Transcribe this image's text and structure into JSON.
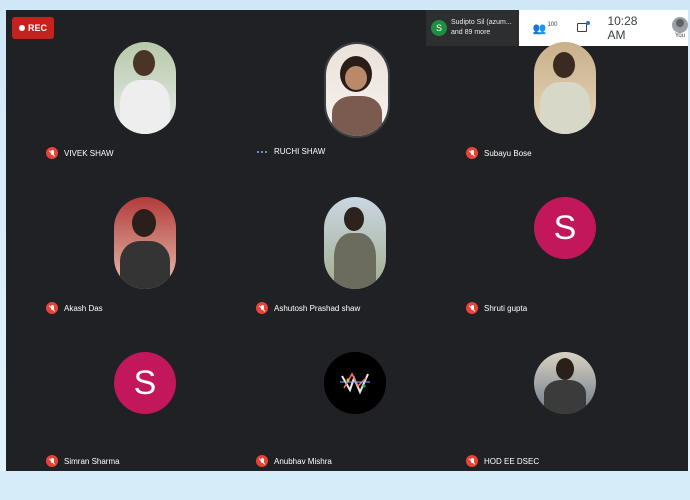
{
  "recording": {
    "label": "REC"
  },
  "topbar": {
    "presenter_initial": "S",
    "presenter_name": "Sudipto Sil (azum...",
    "presenter_more": "and 89 more",
    "participants_count": "100",
    "time": "10:28 AM",
    "you_label": "You"
  },
  "participants": [
    {
      "name": "VIVEK SHAW",
      "status": "muted",
      "avatar": "photo"
    },
    {
      "name": "RUCHI SHAW",
      "status": "speaking",
      "avatar": "photo"
    },
    {
      "name": "Subayu Bose",
      "status": "muted",
      "avatar": "photo"
    },
    {
      "name": "Akash Das",
      "status": "muted",
      "avatar": "photo"
    },
    {
      "name": "Ashutosh Prashad shaw",
      "status": "muted",
      "avatar": "photo"
    },
    {
      "name": "Shruti gupta",
      "status": "muted",
      "avatar": "letter",
      "letter": "S"
    },
    {
      "name": "Simran Sharma",
      "status": "muted",
      "avatar": "letter",
      "letter": "S"
    },
    {
      "name": "Anubhav Mishra",
      "status": "muted",
      "avatar": "art"
    },
    {
      "name": "HOD EE DSEC",
      "status": "muted",
      "avatar": "photo"
    }
  ],
  "colors": {
    "letter_avatar": "#c2185b",
    "mic_off": "#ea4335",
    "rec": "#c5221f",
    "tile_bg": "#202124"
  }
}
